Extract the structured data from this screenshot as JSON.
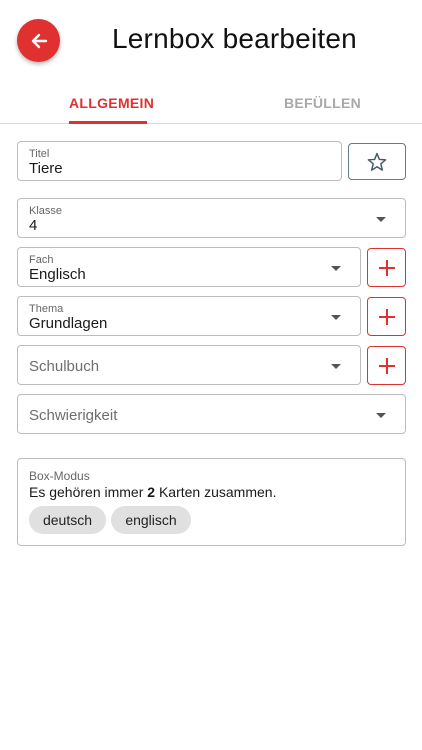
{
  "header": {
    "title": "Lernbox bearbeiten",
    "back_icon": "arrow-left-icon"
  },
  "tabs": [
    {
      "label": "ALLGEMEIN",
      "active": true
    },
    {
      "label": "BEFÜLLEN",
      "active": false
    }
  ],
  "form": {
    "titel": {
      "label": "Titel",
      "value": "Tiere"
    },
    "klasse": {
      "label": "Klasse",
      "value": "4"
    },
    "fach": {
      "label": "Fach",
      "value": "Englisch"
    },
    "thema": {
      "label": "Thema",
      "value": "Grundlagen"
    },
    "schulbuch": {
      "placeholder": "Schulbuch"
    },
    "schwierigkeit": {
      "placeholder": "Schwierigkeit"
    }
  },
  "box_mode": {
    "label": "Box-Modus",
    "text_before": "Es gehören immer ",
    "count": "2",
    "text_after": " Karten zusammen.",
    "chips": [
      "deutsch",
      "englisch"
    ]
  },
  "colors": {
    "accent": "#e03131",
    "star_border": "#607d8b",
    "chip_bg": "#e0e0e0"
  }
}
